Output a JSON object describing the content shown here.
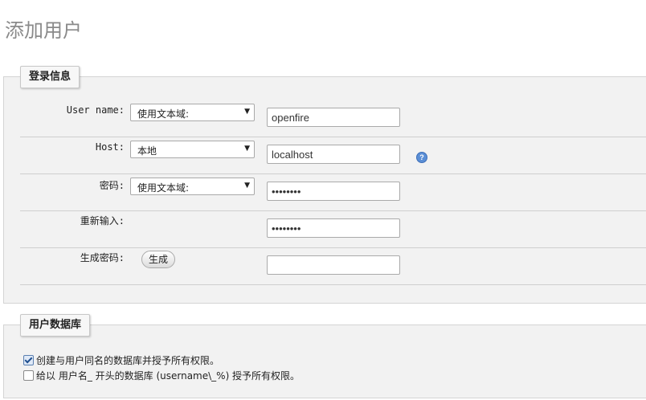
{
  "page": {
    "title": "添加用户"
  },
  "login_section": {
    "legend": "登录信息",
    "username": {
      "label": "User name:",
      "select_value": "使用文本域:",
      "input_value": "openfire"
    },
    "host": {
      "label": "Host:",
      "select_value": "本地",
      "input_value": "localhost",
      "help_icon": "question-circle-icon"
    },
    "password": {
      "label": "密码:",
      "select_value": "使用文本域:",
      "input_value": "••••••••"
    },
    "retype": {
      "label": "重新输入:",
      "input_value": "••••••••"
    },
    "generate": {
      "label": "生成密码:",
      "button_label": "生成",
      "input_value": ""
    }
  },
  "db_section": {
    "legend": "用户数据库",
    "options": [
      {
        "label": "创建与用户同名的数据库并授予所有权限。",
        "checked": true
      },
      {
        "label": "给以 用户名_ 开头的数据库 (username\\_%) 授予所有权限。",
        "checked": false
      }
    ]
  },
  "colors": {
    "background": "#ffffff",
    "section_bg": "#f2f2f2",
    "title": "#8a8a8a",
    "help_icon": "#5b8fd6"
  }
}
